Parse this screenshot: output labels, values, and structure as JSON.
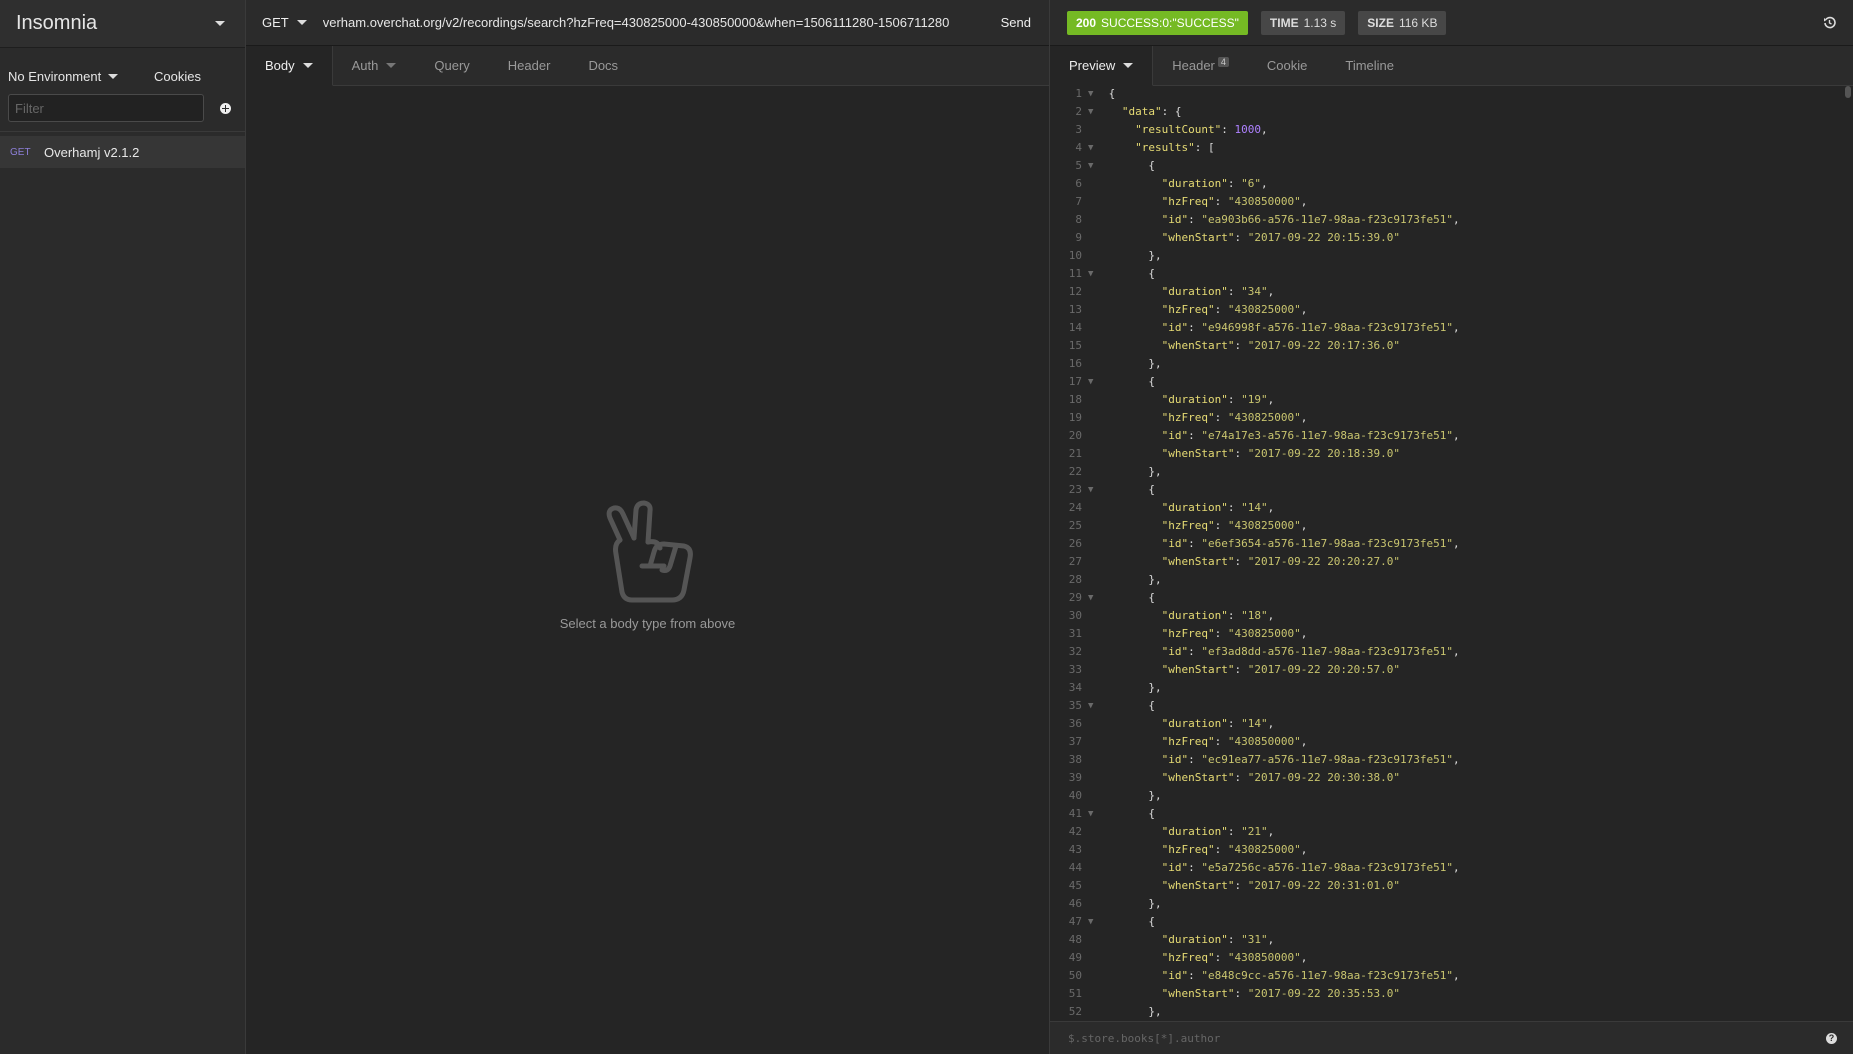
{
  "app": {
    "title": "Insomnia"
  },
  "sidebar": {
    "environment": "No Environment",
    "cookies": "Cookies",
    "filter_placeholder": "Filter",
    "requests": [
      {
        "method": "GET",
        "name": "Overhamj v2.1.2"
      }
    ]
  },
  "request": {
    "method": "GET",
    "url": "verham.overchat.org/v2/recordings/search?hzFreq=430825000-430850000&when=1506111280-1506711280",
    "send_label": "Send",
    "tabs": [
      "Body",
      "Auth",
      "Query",
      "Header",
      "Docs"
    ],
    "empty_hint": "Select a body type from above"
  },
  "response": {
    "status_code": "200",
    "status_text": "SUCCESS:0:\"SUCCESS\"",
    "time_label": "TIME",
    "time_value": "1.13 s",
    "size_label": "SIZE",
    "size_value": "116 KB",
    "tabs": [
      "Preview",
      "Header",
      "Cookie",
      "Timeline"
    ],
    "header_count": "4",
    "filter_placeholder": "$.store.books[*].author",
    "results": [
      {
        "duration": "6",
        "hzFreq": "430850000",
        "id": "ea903b66-a576-11e7-98aa-f23c9173fe51",
        "whenStart": "2017-09-22 20:15:39.0"
      },
      {
        "duration": "34",
        "hzFreq": "430825000",
        "id": "e946998f-a576-11e7-98aa-f23c9173fe51",
        "whenStart": "2017-09-22 20:17:36.0"
      },
      {
        "duration": "19",
        "hzFreq": "430825000",
        "id": "e74a17e3-a576-11e7-98aa-f23c9173fe51",
        "whenStart": "2017-09-22 20:18:39.0"
      },
      {
        "duration": "14",
        "hzFreq": "430825000",
        "id": "e6ef3654-a576-11e7-98aa-f23c9173fe51",
        "whenStart": "2017-09-22 20:20:27.0"
      },
      {
        "duration": "18",
        "hzFreq": "430825000",
        "id": "ef3ad8dd-a576-11e7-98aa-f23c9173fe51",
        "whenStart": "2017-09-22 20:20:57.0"
      },
      {
        "duration": "14",
        "hzFreq": "430850000",
        "id": "ec91ea77-a576-11e7-98aa-f23c9173fe51",
        "whenStart": "2017-09-22 20:30:38.0"
      },
      {
        "duration": "21",
        "hzFreq": "430825000",
        "id": "e5a7256c-a576-11e7-98aa-f23c9173fe51",
        "whenStart": "2017-09-22 20:31:01.0"
      },
      {
        "duration": "31",
        "hzFreq": "430850000",
        "id": "e848c9cc-a576-11e7-98aa-f23c9173fe51",
        "whenStart": "2017-09-22 20:35:53.0"
      }
    ],
    "result_count": "1000"
  }
}
